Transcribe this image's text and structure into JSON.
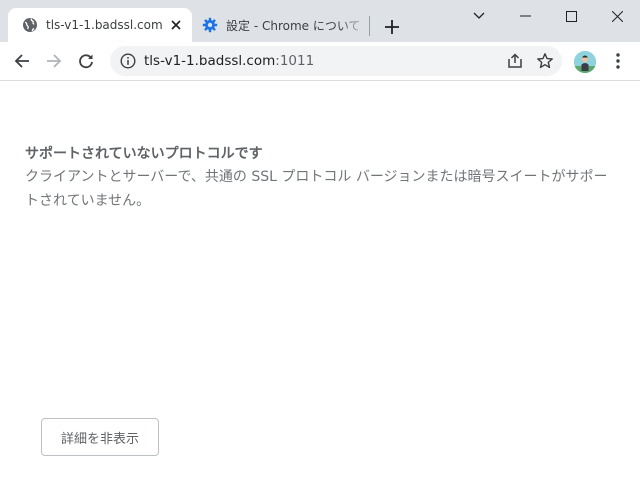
{
  "tabs": [
    {
      "title": "tls-v1-1.badssl.com",
      "active": true,
      "favicon": "globe-icon"
    },
    {
      "title": "設定 - Chrome について",
      "active": false,
      "favicon": "gear-icon"
    }
  ],
  "window_controls": [
    "chevron-down-icon",
    "minimize-icon",
    "maximize-icon",
    "close-icon"
  ],
  "toolbar": {
    "back_icon": "arrow-left-icon",
    "forward_icon": "arrow-right-icon",
    "reload_icon": "reload-icon",
    "url_host": "tls-v1-1.badssl.com",
    "url_port": ":1011",
    "share_icon": "share-icon",
    "bookmark_icon": "star-icon",
    "menu_icon": "kebab-icon"
  },
  "error": {
    "heading": "サポートされていないプロトコルです",
    "description": "クライアントとサーバーで、共通の SSL プロトコル バージョンまたは暗号スイートがサポートされていません。",
    "details_button": "詳細を非表示"
  },
  "colors": {
    "tabstrip": "#dee1e6",
    "accent": "#1a73e8",
    "text_secondary": "#5f6368"
  }
}
